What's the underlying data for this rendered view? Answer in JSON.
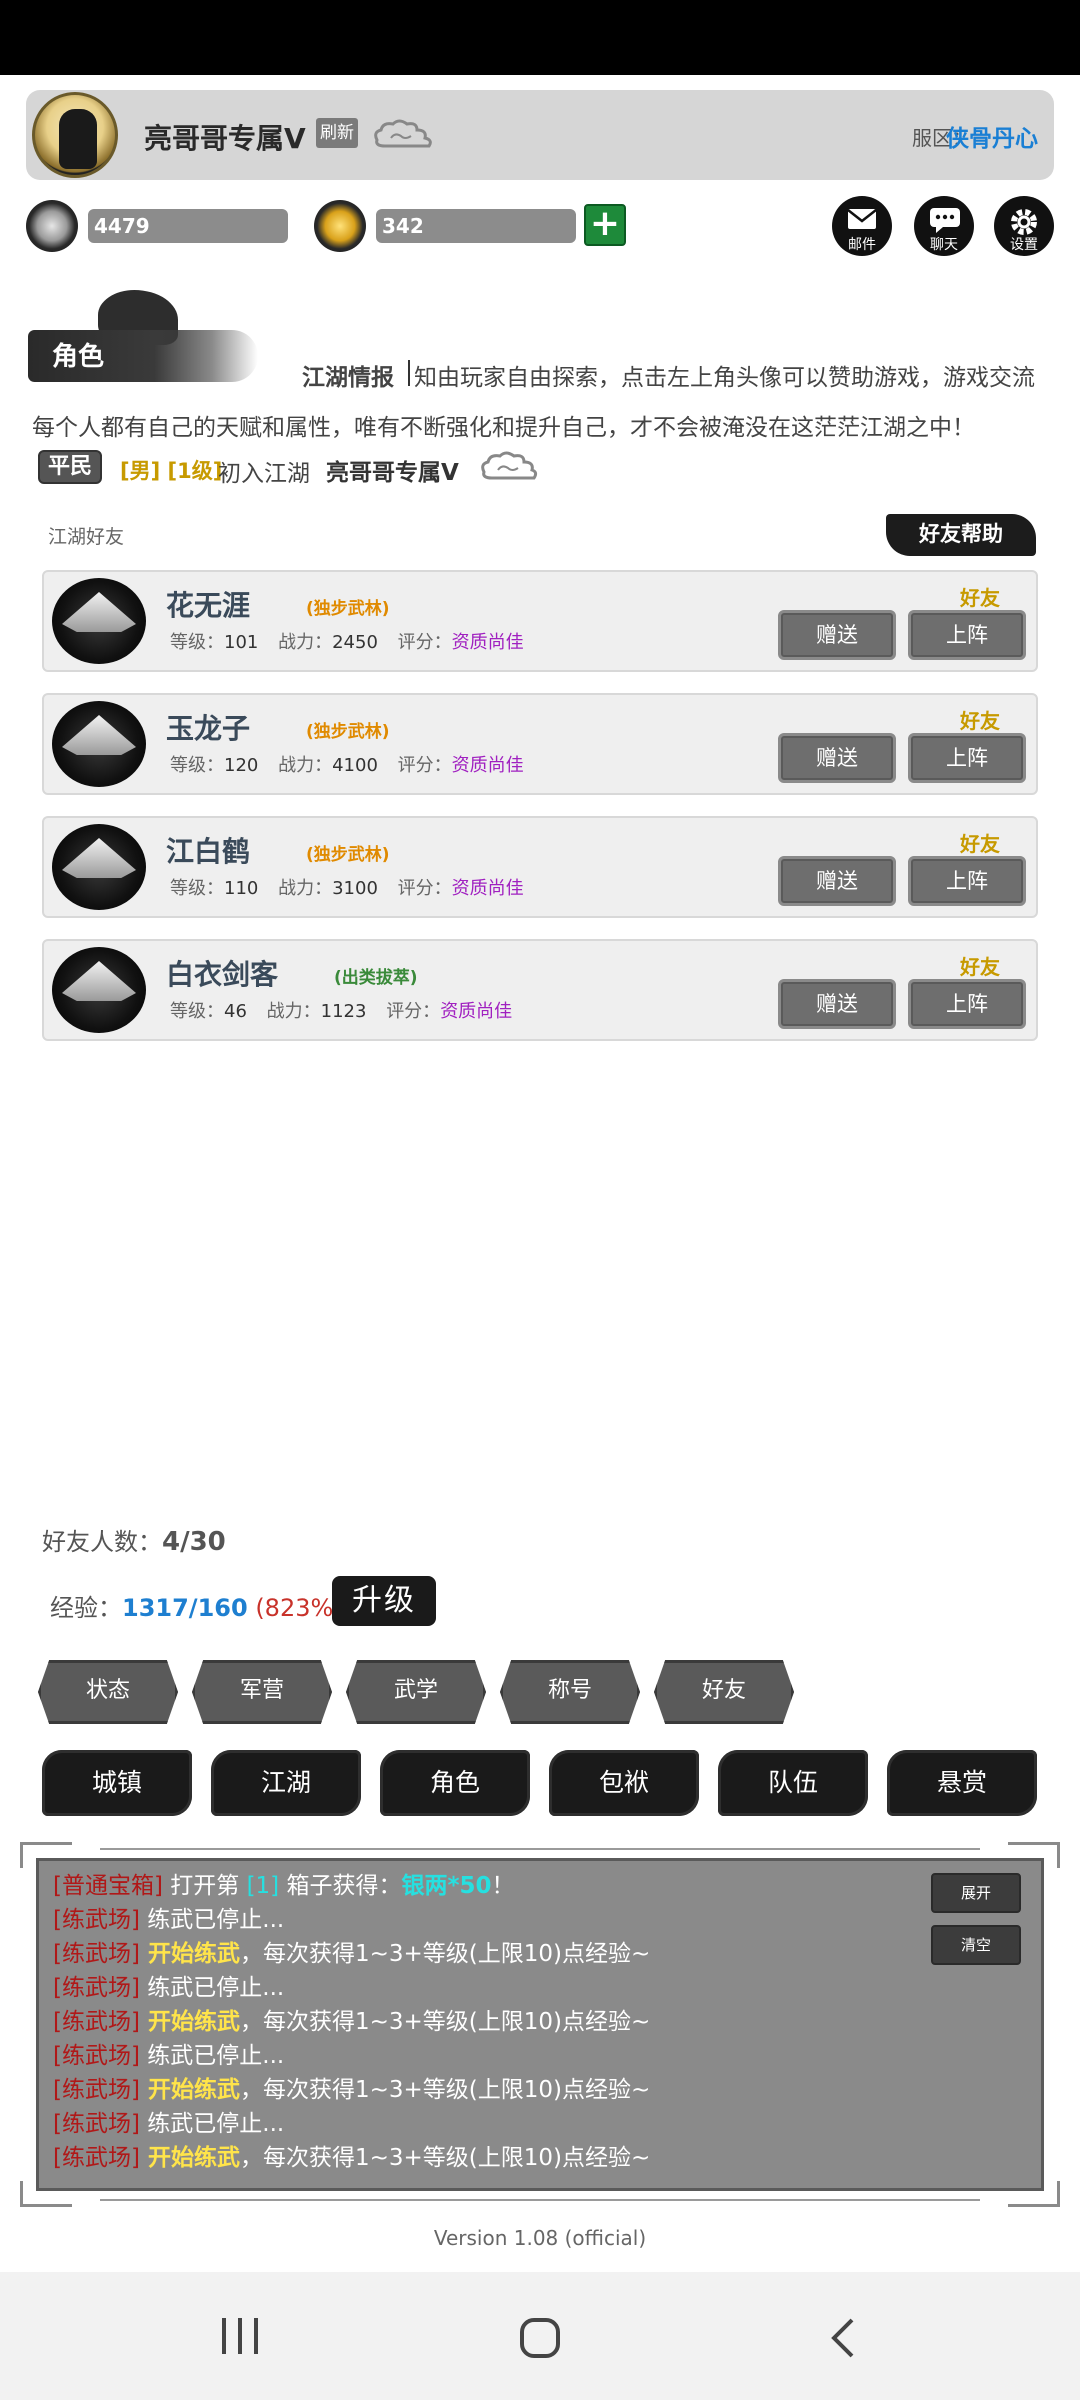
{
  "header": {
    "player_name": "亮哥哥专属V",
    "refresh_label": "刷新",
    "server_label": "服区：",
    "server_name": "侠骨丹心"
  },
  "currency": {
    "silver": "4479",
    "gold": "342",
    "plus": "+"
  },
  "top_icons": {
    "mail": "邮件",
    "chat": "聊天",
    "settings": "设置"
  },
  "role_banner": "角色",
  "news": {
    "label": "江湖情报",
    "text": "知由玩家自由探索，点击左上角头像可以赞助游戏，游戏交流"
  },
  "intro": "每个人都有自己的天赋和属性，唯有不断强化和提升自己，才不会被淹没在这茫茫江湖之中！",
  "profile": {
    "rank": "平民",
    "gender_level": "[男] [1级]",
    "status": "初入江湖",
    "name": "亮哥哥专属V"
  },
  "friends_section": {
    "title": "江湖好友",
    "help_button": "好友帮助",
    "stat_labels": {
      "level": "等级：",
      "power": "战力：",
      "rating": "评分："
    },
    "gift_label": "赠送",
    "deploy_label": "上阵",
    "items": [
      {
        "name": "花无涯",
        "tag": "(独步武林)",
        "level": "101",
        "power": "2450",
        "rating": "资质尚佳",
        "relation": "好友"
      },
      {
        "name": "玉龙子",
        "tag": "(独步武林)",
        "level": "120",
        "power": "4100",
        "rating": "资质尚佳",
        "relation": "好友"
      },
      {
        "name": "江白鹤",
        "tag": "(独步武林)",
        "level": "110",
        "power": "3100",
        "rating": "资质尚佳",
        "relation": "好友"
      },
      {
        "name": "白衣剑客",
        "tag": "(出类拔萃)",
        "level": "46",
        "power": "1123",
        "rating": "资质尚佳",
        "relation": "好友"
      }
    ]
  },
  "friend_count": {
    "label": "好友人数：",
    "value": "4/30"
  },
  "exp": {
    "label": "经验：",
    "value": "1317/160",
    "percent": "(823%)",
    "upgrade": "升级"
  },
  "tabs": [
    "状态",
    "军营",
    "武学",
    "称号",
    "好友"
  ],
  "nav": [
    "城镇",
    "江湖",
    "角色",
    "包袱",
    "队伍",
    "悬赏"
  ],
  "log": {
    "expand": "展开",
    "clear": "清空",
    "first": {
      "tag": "[普通宝箱]",
      "t1": " 打开第 ",
      "num": "[1]",
      "t2": " 箱子获得：",
      "reward": "银两*50",
      "t3": "！"
    },
    "lines": [
      {
        "tag": "[练武场]",
        "highlight": "",
        "text": " 练武已停止..."
      },
      {
        "tag": "[练武场]",
        "highlight": " 开始练武",
        "text": "，每次获得1~3+等级(上限10)点经验~"
      },
      {
        "tag": "[练武场]",
        "highlight": "",
        "text": " 练武已停止..."
      },
      {
        "tag": "[练武场]",
        "highlight": " 开始练武",
        "text": "，每次获得1~3+等级(上限10)点经验~"
      },
      {
        "tag": "[练武场]",
        "highlight": "",
        "text": " 练武已停止..."
      },
      {
        "tag": "[练武场]",
        "highlight": " 开始练武",
        "text": "，每次获得1~3+等级(上限10)点经验~"
      },
      {
        "tag": "[练武场]",
        "highlight": "",
        "text": " 练武已停止..."
      },
      {
        "tag": "[练武场]",
        "highlight": " 开始练武",
        "text": "，每次获得1~3+等级(上限10)点经验~"
      }
    ]
  },
  "version": "Version 1.08 (official)"
}
